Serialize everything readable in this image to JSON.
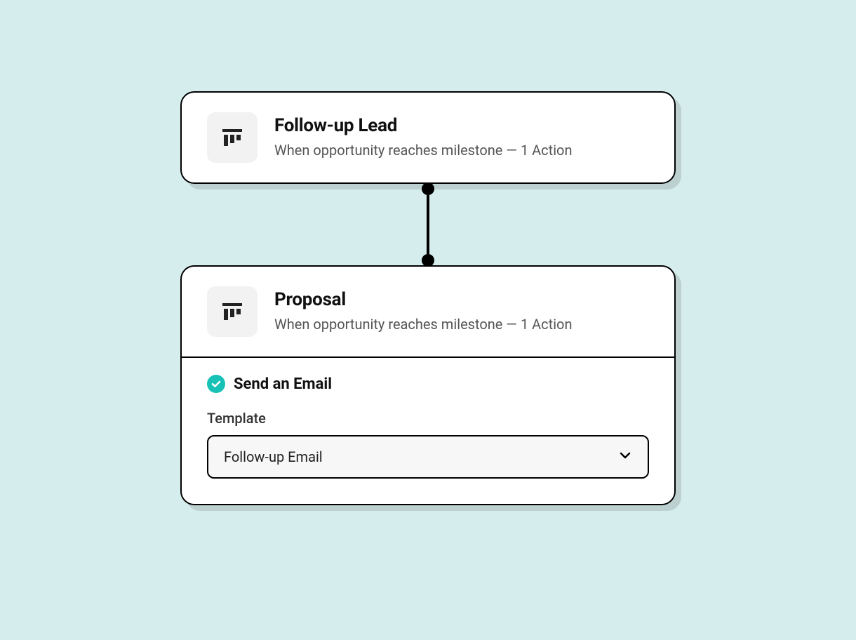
{
  "trigger": {
    "title": "Follow-up Lead",
    "subtitle": "When opportunity reaches milestone — 1 Action"
  },
  "node": {
    "title": "Proposal",
    "subtitle": "When opportunity reaches milestone — 1 Action"
  },
  "action": {
    "title": "Send an Email",
    "template_label": "Template",
    "template_value": "Follow-up Email"
  }
}
